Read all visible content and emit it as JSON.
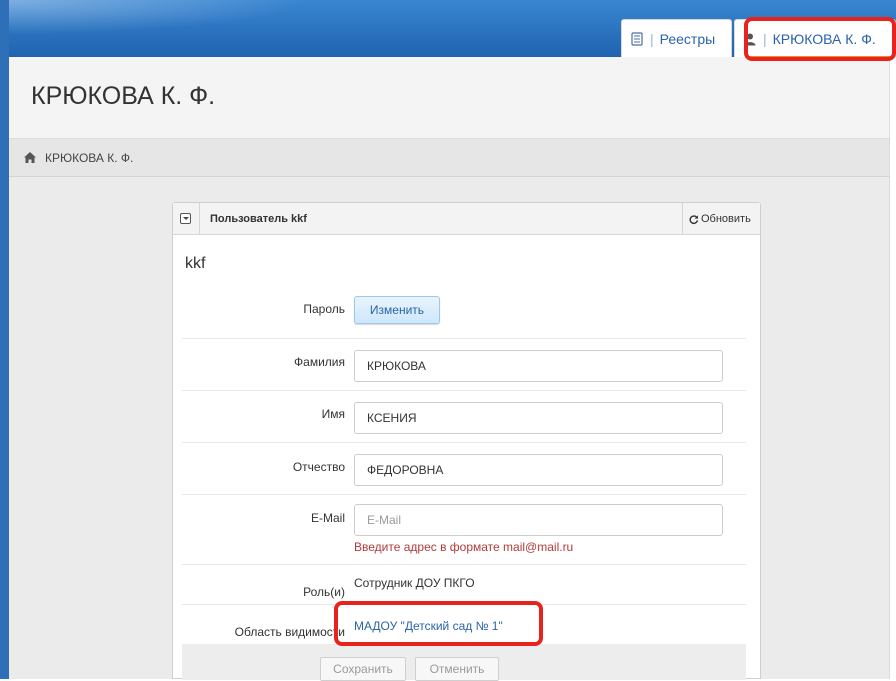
{
  "header": {
    "tabs": [
      {
        "label": "Реестры",
        "icon": "document-icon"
      },
      {
        "label": "КРЮКОВА К. Ф.",
        "icon": "user-icon"
      }
    ]
  },
  "page": {
    "title": "КРЮКОВА К. Ф."
  },
  "breadcrumb": {
    "icon": "home-icon",
    "label": "КРЮКОВА К. Ф."
  },
  "panel": {
    "title": "Пользователь kkf",
    "refresh_label": "Обновить",
    "login": "kkf",
    "fields": {
      "password_label": "Пароль",
      "change_button": "Изменить",
      "lastname_label": "Фамилия",
      "lastname_value": "КРЮКОВА",
      "firstname_label": "Имя",
      "firstname_value": "КСЕНИЯ",
      "middlename_label": "Отчество",
      "middlename_value": "ФЕДОРОВНА",
      "email_label": "E-Mail",
      "email_value": "",
      "email_placeholder": "E-Mail",
      "email_error": "Введите адрес в формате mail@mail.ru",
      "role_label": "Роль(и)",
      "role_value": "Сотрудник ДОУ ПКГО",
      "scope_label": "Область видимости",
      "scope_value": "МАДОУ \"Детский сад № 1\""
    },
    "save_button": "Сохранить",
    "cancel_button": "Отменить"
  },
  "colors": {
    "header_blue": "#2f6fb7",
    "tab_accent": "#f28a1e",
    "highlight": "#e8231e",
    "link": "#2a64a8",
    "error": "#b33a3a"
  }
}
